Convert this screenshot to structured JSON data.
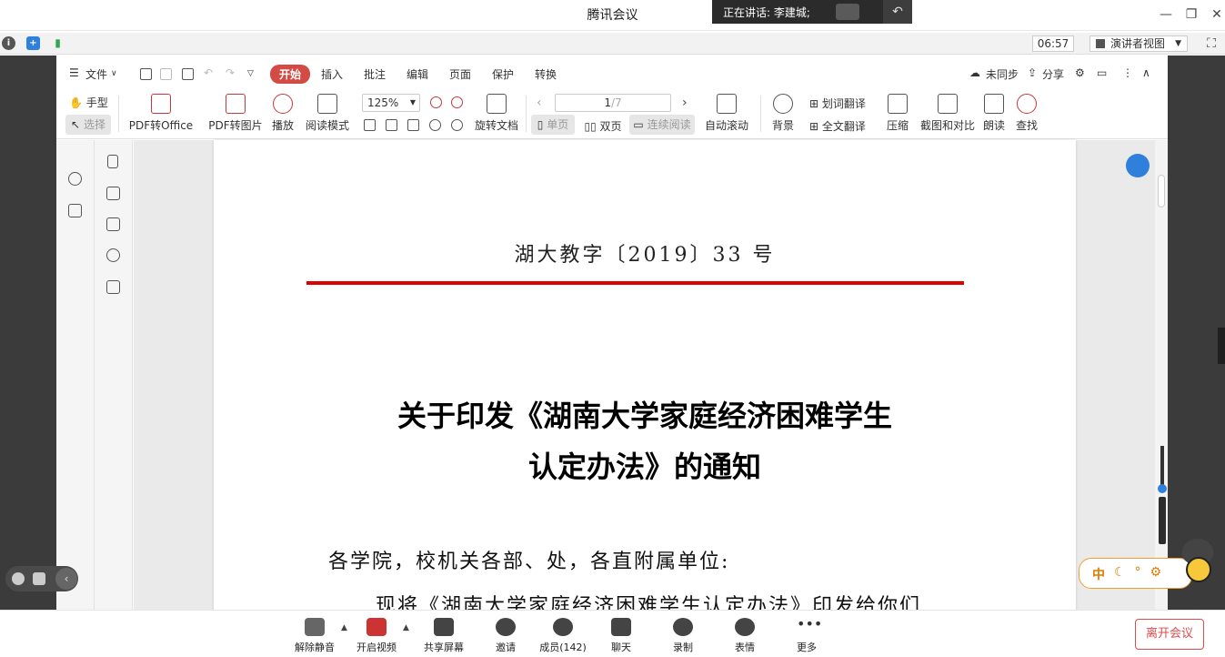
{
  "meeting": {
    "app_title": "腾讯会议",
    "speaking_label": "正在讲话: 李建城;",
    "timer": "06:57",
    "presenter_view": "演讲者视图",
    "leave_label": "离开会议",
    "bottom_buttons": {
      "unmute": "解除静音",
      "video": "开启视频",
      "share": "共享屏幕",
      "invite": "邀请",
      "members": "成员(142)",
      "chat": "聊天",
      "record": "录制",
      "emoji": "表情",
      "more": "更多"
    }
  },
  "wps": {
    "menu": {
      "file": "文件",
      "start": "开始",
      "insert": "插入",
      "annotate": "批注",
      "edit": "编辑",
      "page": "页面",
      "protect": "保护",
      "convert": "转换",
      "unsynced": "未同步",
      "share": "分享"
    },
    "toolbar": {
      "hand": "手型",
      "select": "选择",
      "pdf_to_office": "PDF转Office",
      "pdf_to_image": "PDF转图片",
      "play": "播放",
      "read_mode": "阅读模式",
      "zoom": "125%",
      "rotate": "旋转文档",
      "page_current": "1",
      "page_total": "/7",
      "single_page": "单页",
      "double_page": "双页",
      "continuous": "连续阅读",
      "auto_scroll": "自动滚动",
      "background": "背景",
      "word_translate": "划词翻译",
      "full_translate": "全文翻译",
      "compress": "压缩",
      "capture_compare": "截图和对比",
      "read_aloud": "朗读",
      "find": "查找"
    },
    "colors": {
      "accent_red": "#d24b44",
      "rule_red": "#e00000",
      "sync_blue": "#2f7fdc"
    }
  },
  "document": {
    "number": "湖大教字〔2019〕33 号",
    "title_line1": "关于印发《湖南大学家庭经济困难学生",
    "title_line2": "认定办法》的通知",
    "addressee": "各学院，校机关各部、处，各直附属单位:",
    "body_line1": "现将《湖南大学家庭经济困难学生认定办法》印发给你们,"
  }
}
